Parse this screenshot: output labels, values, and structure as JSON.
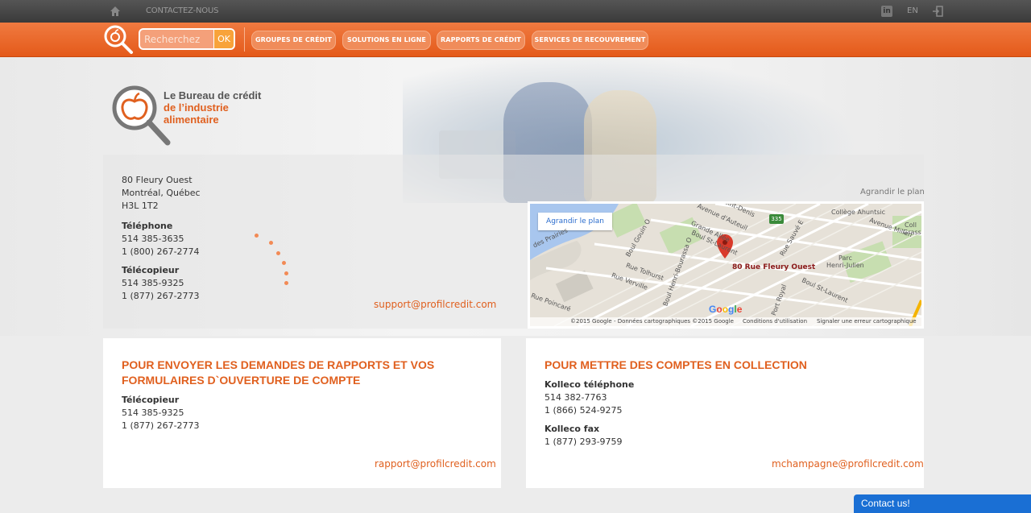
{
  "topbar": {
    "contact_label": "CONTACTEZ-NOUS",
    "lang_label": "EN"
  },
  "search": {
    "placeholder": "Recherchez",
    "button_label": "OK"
  },
  "nav": [
    {
      "label": "GROUPES DE CRÉDIT"
    },
    {
      "label": "SOLUTIONS EN LIGNE"
    },
    {
      "label": "RAPPORTS DE CRÉDIT"
    },
    {
      "label": "SERVICES DE RECOUVREMENT"
    }
  ],
  "logo": {
    "line1": "Le Bureau de crédit",
    "line2": "de l’industrie",
    "line3": "alimentaire"
  },
  "address": {
    "street": "80 Fleury Ouest",
    "city": "Montréal, Québec",
    "postal": "H3L 1T2",
    "phone_label": "Téléphone",
    "phone1": "514 385-3635",
    "phone2": "1 (800) 267-2774",
    "fax_label": "Télécopieur",
    "fax1": "514 385-9325",
    "fax2": "1 (877) 267-2773",
    "email": "support@profilcredit.com"
  },
  "map": {
    "enlarge_top": "Agrandir le plan",
    "enlarge_button": "Agrandir le plan",
    "pin_label": "80 Rue Fleury Ouest",
    "labels": {
      "college": "Collège Ahuntsic",
      "avenue_millen": "Avenue Millen",
      "parc": "Parc",
      "henri_julien": "Henri-Julien",
      "avenue_auteuil": "Avenue d'Auteuil",
      "saint_denis": "Saint-Denis",
      "grande_allee": "Grande Allée",
      "bd_st_laurent_top": "Boul St-Laurent",
      "bd_st_laurent": "Boul St-Laurent",
      "rue_tolhurst": "Rue Tolhurst",
      "rue_verville": "Rue Verville",
      "boul_gouin": "Boul Gouin O",
      "henri_bourassa": "Boul Henri-Bourassa O",
      "rue_poincare": "Rue Poincaré",
      "port_royal": "Port Royal",
      "sauve": "Rue Sauvé E",
      "des_prairies": "des Prairies",
      "coll": "Coll",
      "grass": "Grass",
      "highway": "335"
    },
    "logo": "Google",
    "footer": {
      "copyright": "©2015 Google - Données cartographiques ©2015 Google",
      "terms": "Conditions d'utilisation",
      "report": "Signaler une erreur cartographique"
    }
  },
  "cards": [
    {
      "title": "POUR ENVOYER LES DEMANDES DE RAPPORTS ET VOS FORMULAIRES D`OUVERTURE DE COMPTE",
      "fax_label": "Télécopieur",
      "fax1": "514 385-9325",
      "fax2": "1 (877) 267-2773",
      "email": "rapport@profilcredit.com"
    },
    {
      "title": "POUR METTRE DES COMPTES EN COLLECTION",
      "phone_label": "Kolleco téléphone",
      "phone1": "514 382-7763",
      "phone2": "1 (866) 524-9275",
      "fax_label": "Kolleco fax",
      "fax1": "1 (877) 293-9759",
      "email": "mchampagne@profilcredit.com"
    }
  ],
  "chat": {
    "label": "Contact us!"
  },
  "colors": {
    "accent": "#e0601f",
    "nav_bg": "#f08c5a",
    "dark_bar": "#3a3a3a",
    "chat": "#1a6fd4"
  },
  "icons": [
    "home-icon",
    "linkedin-icon",
    "login-icon",
    "magnifier-apple-icon",
    "map-pin-icon"
  ]
}
